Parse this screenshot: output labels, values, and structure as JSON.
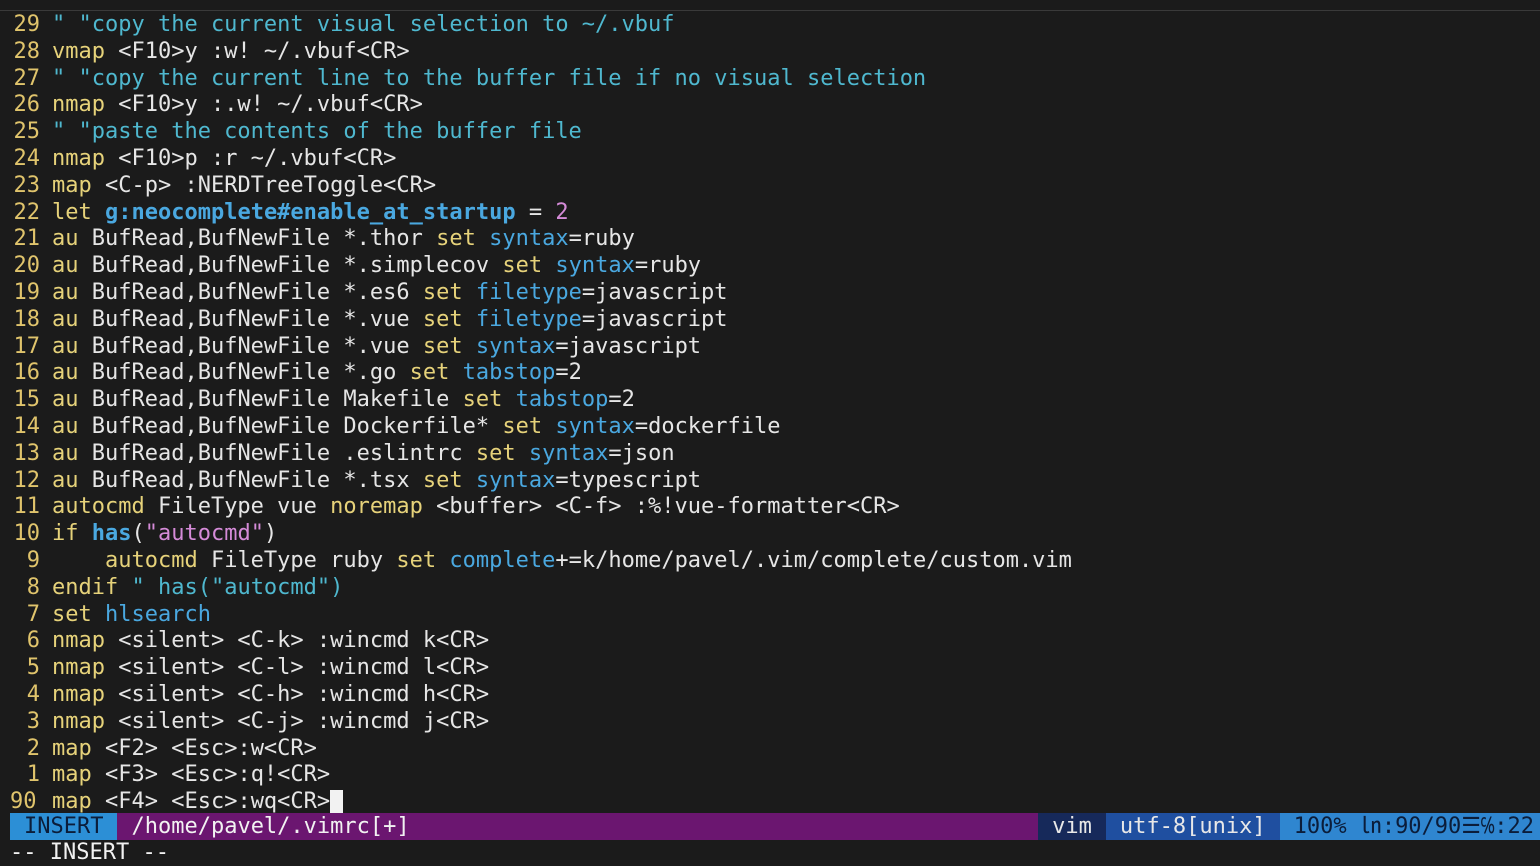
{
  "lines": [
    {
      "n": "29",
      "segs": [
        {
          "c": "cm",
          "t": "\" \"copy the current visual selection to ~/.vbuf"
        }
      ]
    },
    {
      "n": "28",
      "segs": [
        {
          "c": "kw",
          "t": "vmap"
        },
        {
          "c": "pl",
          "t": " <F10>y :w! ~/.vbuf<CR>"
        }
      ]
    },
    {
      "n": "27",
      "segs": [
        {
          "c": "cm",
          "t": "\" \"copy the current line to the buffer file if no visual selection"
        }
      ]
    },
    {
      "n": "26",
      "segs": [
        {
          "c": "kw",
          "t": "nmap"
        },
        {
          "c": "pl",
          "t": " <F10>y :.w! ~/.vbuf<CR>"
        }
      ]
    },
    {
      "n": "25",
      "segs": [
        {
          "c": "cm",
          "t": "\" \"paste the contents of the buffer file"
        }
      ]
    },
    {
      "n": "24",
      "segs": [
        {
          "c": "kw",
          "t": "nmap"
        },
        {
          "c": "pl",
          "t": " <F10>p :r ~/.vbuf<CR>"
        }
      ]
    },
    {
      "n": "23",
      "segs": [
        {
          "c": "kw",
          "t": "map"
        },
        {
          "c": "pl",
          "t": " <C-p> :NERDTreeToggle<CR>"
        }
      ]
    },
    {
      "n": "22",
      "segs": [
        {
          "c": "kw",
          "t": "let"
        },
        {
          "c": "pl",
          "t": " "
        },
        {
          "c": "gv",
          "t": "g:neocomplete#enable_at_startup"
        },
        {
          "c": "pl",
          "t": " = "
        },
        {
          "c": "num",
          "t": "2"
        }
      ]
    },
    {
      "n": "21",
      "segs": [
        {
          "c": "kw",
          "t": "au"
        },
        {
          "c": "pl",
          "t": " BufRead,BufNewFile *.thor "
        },
        {
          "c": "kw",
          "t": "set"
        },
        {
          "c": "pl",
          "t": " "
        },
        {
          "c": "op",
          "t": "syntax"
        },
        {
          "c": "pl",
          "t": "=ruby"
        }
      ]
    },
    {
      "n": "20",
      "segs": [
        {
          "c": "kw",
          "t": "au"
        },
        {
          "c": "pl",
          "t": " BufRead,BufNewFile *.simplecov "
        },
        {
          "c": "kw",
          "t": "set"
        },
        {
          "c": "pl",
          "t": " "
        },
        {
          "c": "op",
          "t": "syntax"
        },
        {
          "c": "pl",
          "t": "=ruby"
        }
      ]
    },
    {
      "n": "19",
      "segs": [
        {
          "c": "kw",
          "t": "au"
        },
        {
          "c": "pl",
          "t": " BufRead,BufNewFile *.es6 "
        },
        {
          "c": "kw",
          "t": "set"
        },
        {
          "c": "pl",
          "t": " "
        },
        {
          "c": "op",
          "t": "filetype"
        },
        {
          "c": "pl",
          "t": "=javascript"
        }
      ]
    },
    {
      "n": "18",
      "segs": [
        {
          "c": "kw",
          "t": "au"
        },
        {
          "c": "pl",
          "t": " BufRead,BufNewFile *.vue "
        },
        {
          "c": "kw",
          "t": "set"
        },
        {
          "c": "pl",
          "t": " "
        },
        {
          "c": "op",
          "t": "filetype"
        },
        {
          "c": "pl",
          "t": "=javascript"
        }
      ]
    },
    {
      "n": "17",
      "segs": [
        {
          "c": "kw",
          "t": "au"
        },
        {
          "c": "pl",
          "t": " BufRead,BufNewFile *.vue "
        },
        {
          "c": "kw",
          "t": "set"
        },
        {
          "c": "pl",
          "t": " "
        },
        {
          "c": "op",
          "t": "syntax"
        },
        {
          "c": "pl",
          "t": "=javascript"
        }
      ]
    },
    {
      "n": "16",
      "segs": [
        {
          "c": "kw",
          "t": "au"
        },
        {
          "c": "pl",
          "t": " BufRead,BufNewFile *.go "
        },
        {
          "c": "kw",
          "t": "set"
        },
        {
          "c": "pl",
          "t": " "
        },
        {
          "c": "op",
          "t": "tabstop"
        },
        {
          "c": "pl",
          "t": "=2"
        }
      ]
    },
    {
      "n": "15",
      "segs": [
        {
          "c": "kw",
          "t": "au"
        },
        {
          "c": "pl",
          "t": " BufRead,BufNewFile Makefile "
        },
        {
          "c": "kw",
          "t": "set"
        },
        {
          "c": "pl",
          "t": " "
        },
        {
          "c": "op",
          "t": "tabstop"
        },
        {
          "c": "pl",
          "t": "=2"
        }
      ]
    },
    {
      "n": "14",
      "segs": [
        {
          "c": "kw",
          "t": "au"
        },
        {
          "c": "pl",
          "t": " BufRead,BufNewFile Dockerfile* "
        },
        {
          "c": "kw",
          "t": "set"
        },
        {
          "c": "pl",
          "t": " "
        },
        {
          "c": "op",
          "t": "syntax"
        },
        {
          "c": "pl",
          "t": "=dockerfile"
        }
      ]
    },
    {
      "n": "13",
      "segs": [
        {
          "c": "kw",
          "t": "au"
        },
        {
          "c": "pl",
          "t": " BufRead,BufNewFile .eslintrc "
        },
        {
          "c": "kw",
          "t": "set"
        },
        {
          "c": "pl",
          "t": " "
        },
        {
          "c": "op",
          "t": "syntax"
        },
        {
          "c": "pl",
          "t": "=json"
        }
      ]
    },
    {
      "n": "12",
      "segs": [
        {
          "c": "kw",
          "t": "au"
        },
        {
          "c": "pl",
          "t": " BufRead,BufNewFile *.tsx "
        },
        {
          "c": "kw",
          "t": "set"
        },
        {
          "c": "pl",
          "t": " "
        },
        {
          "c": "op",
          "t": "syntax"
        },
        {
          "c": "pl",
          "t": "=typescript"
        }
      ]
    },
    {
      "n": "11",
      "segs": [
        {
          "c": "kw",
          "t": "autocmd"
        },
        {
          "c": "pl",
          "t": " FileType vue "
        },
        {
          "c": "kw",
          "t": "noremap"
        },
        {
          "c": "pl",
          "t": " <buffer> <C-f> :%!vue-formatter<CR>"
        }
      ]
    },
    {
      "n": "10",
      "segs": [
        {
          "c": "kw",
          "t": "if"
        },
        {
          "c": "pl",
          "t": " "
        },
        {
          "c": "fn",
          "t": "has"
        },
        {
          "c": "pl",
          "t": "("
        },
        {
          "c": "num",
          "t": "\"autocmd\""
        },
        {
          "c": "pl",
          "t": ")"
        }
      ]
    },
    {
      "n": "9",
      "segs": [
        {
          "c": "pl",
          "t": "    "
        },
        {
          "c": "kw",
          "t": "autocmd"
        },
        {
          "c": "pl",
          "t": " FileType ruby "
        },
        {
          "c": "kw",
          "t": "set"
        },
        {
          "c": "pl",
          "t": " "
        },
        {
          "c": "op",
          "t": "complete"
        },
        {
          "c": "pl",
          "t": "+=k/home/pavel/.vim/complete/custom.vim"
        }
      ]
    },
    {
      "n": "8",
      "segs": [
        {
          "c": "kw",
          "t": "endif"
        },
        {
          "c": "pl",
          "t": " "
        },
        {
          "c": "cm",
          "t": "\" has(\"autocmd\")"
        }
      ]
    },
    {
      "n": "7",
      "segs": [
        {
          "c": "kw",
          "t": "set"
        },
        {
          "c": "pl",
          "t": " "
        },
        {
          "c": "op",
          "t": "hlsearch"
        }
      ]
    },
    {
      "n": "6",
      "segs": [
        {
          "c": "kw",
          "t": "nmap"
        },
        {
          "c": "pl",
          "t": " <silent> <C-k> :wincmd k<CR>"
        }
      ]
    },
    {
      "n": "5",
      "segs": [
        {
          "c": "kw",
          "t": "nmap"
        },
        {
          "c": "pl",
          "t": " <silent> <C-l> :wincmd l<CR>"
        }
      ]
    },
    {
      "n": "4",
      "segs": [
        {
          "c": "kw",
          "t": "nmap"
        },
        {
          "c": "pl",
          "t": " <silent> <C-h> :wincmd h<CR>"
        }
      ]
    },
    {
      "n": "3",
      "segs": [
        {
          "c": "kw",
          "t": "nmap"
        },
        {
          "c": "pl",
          "t": " <silent> <C-j> :wincmd j<CR>"
        }
      ]
    },
    {
      "n": "2",
      "segs": [
        {
          "c": "kw",
          "t": "map"
        },
        {
          "c": "pl",
          "t": " <F2> <Esc>:w<CR>"
        }
      ]
    },
    {
      "n": "1",
      "segs": [
        {
          "c": "kw",
          "t": "map"
        },
        {
          "c": "pl",
          "t": " <F3> <Esc>:q!<CR>"
        }
      ]
    },
    {
      "n": "90",
      "current": true,
      "segs": [
        {
          "c": "kw",
          "t": "map"
        },
        {
          "c": "pl",
          "t": " <F4> <Esc>:wq<CR>"
        }
      ]
    }
  ],
  "statusline": {
    "mode": "INSERT",
    "file": "/home/pavel/.vimrc[+]",
    "filetype": "vim",
    "encoding": "utf-8[unix]",
    "position": "100% ㏑:90/90☰℅:22"
  },
  "cmdline": "-- INSERT --",
  "colors": {
    "background": "#1b1b1b",
    "statusline": "#6b1670",
    "mode": "#2c8fd6",
    "comment": "#4fb8cf",
    "keyword": "#e6d27a"
  }
}
